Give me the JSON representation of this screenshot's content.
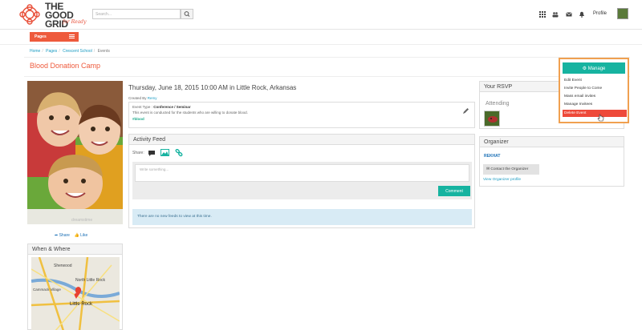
{
  "header": {
    "logo_line1": "THE",
    "logo_line2": "GOOD",
    "logo_line3": "GRID",
    "logo_script": "for Ready",
    "search_placeholder": "Search...",
    "profile_label": "Profile",
    "icons": [
      "grid-icon",
      "people-icon",
      "mail-icon",
      "bell-icon"
    ]
  },
  "pages_button": "Pages",
  "breadcrumb": [
    "Home",
    "Pages",
    "Crescent School",
    "Events"
  ],
  "page_title": "Blood Donation Camp",
  "event": {
    "date": "Thursday, June 18, 2015 10:00 AM in Little Rock, Arkansas",
    "created_by_label": "Created By",
    "created_by": "Remy",
    "type_label": "Event Type :",
    "type_value": "Conference / Seminar",
    "description": "This event is conducted for the students who are willing to donate blood.",
    "tag": "#blood",
    "image_watermark": "dreamstime"
  },
  "share": {
    "share_label": "Share",
    "like_label": "Like"
  },
  "when_where": {
    "title": "When & Where",
    "map_labels": [
      "Little Rock",
      "North Little Rock",
      "Cammack Village",
      "Sherwood"
    ]
  },
  "activity": {
    "title": "Activity Feed",
    "share_label": "Share:",
    "write_placeholder": "Write something...",
    "comment_button": "Comment",
    "empty_message": "There are no new feeds to view at this time."
  },
  "rsvp": {
    "title": "Your RSVP",
    "status": "Attending"
  },
  "organizer": {
    "title": "Organizer",
    "name": "REKHAT",
    "contact_button": "Contact the Organizer",
    "profile_link": "View Organizer profile"
  },
  "manage": {
    "button": "Manage",
    "items": [
      "Edit Event",
      "Invite People to Come",
      "Mass email invites",
      "Manage Invitees",
      "Delete Event"
    ]
  },
  "colors": {
    "accent": "#ee5a3c",
    "teal": "#16b3a0",
    "link": "#1a9bc2",
    "highlight": "#f0a050"
  }
}
